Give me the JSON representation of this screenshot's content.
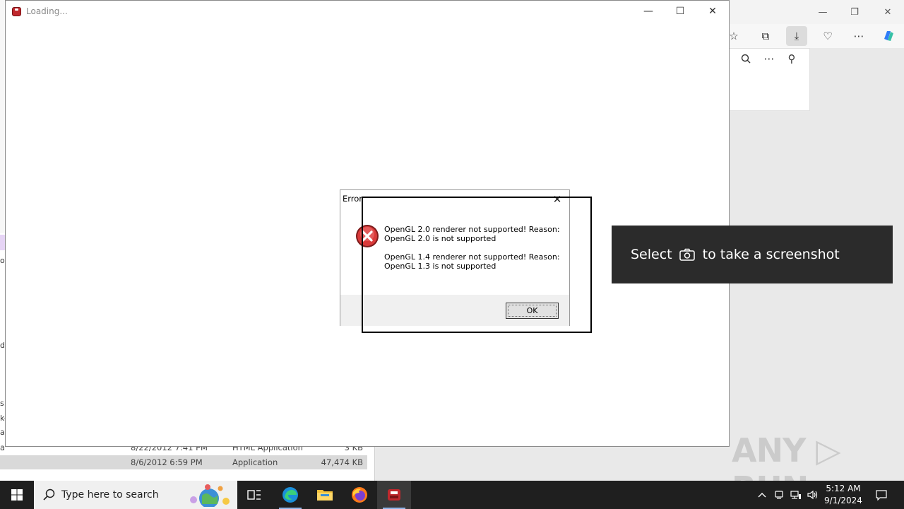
{
  "main_window": {
    "title": "Loading...",
    "minimize": "—",
    "maximize": "☐",
    "close": "✕"
  },
  "error_dialog": {
    "title": "Error",
    "close": "✕",
    "message_1": "OpenGL 2.0 renderer not supported! Reason:\nOpenGL 2.0 is not supported",
    "message_2": "OpenGL 1.4 renderer not supported! Reason:\nOpenGL 1.3 is not supported",
    "ok_label": "OK"
  },
  "toast": {
    "prefix": "Select",
    "camera_icon": "camera-icon",
    "suffix": "to take a screenshot"
  },
  "explorer": {
    "rows": [
      {
        "date": "8/22/2012 7:41 PM",
        "type": "HTML Application",
        "size": "3 KB",
        "name": "a"
      },
      {
        "date": "8/6/2012 6:59 PM",
        "type": "Application",
        "size": "47,474 KB",
        "name": ""
      }
    ],
    "fragments": [
      "op",
      "d",
      "s.",
      "ke",
      "af"
    ]
  },
  "watermark": "ANY ▷ RUN",
  "taskbar": {
    "search_placeholder": "Type here to search",
    "clock_time": "5:12 AM",
    "clock_date": "9/1/2024"
  }
}
